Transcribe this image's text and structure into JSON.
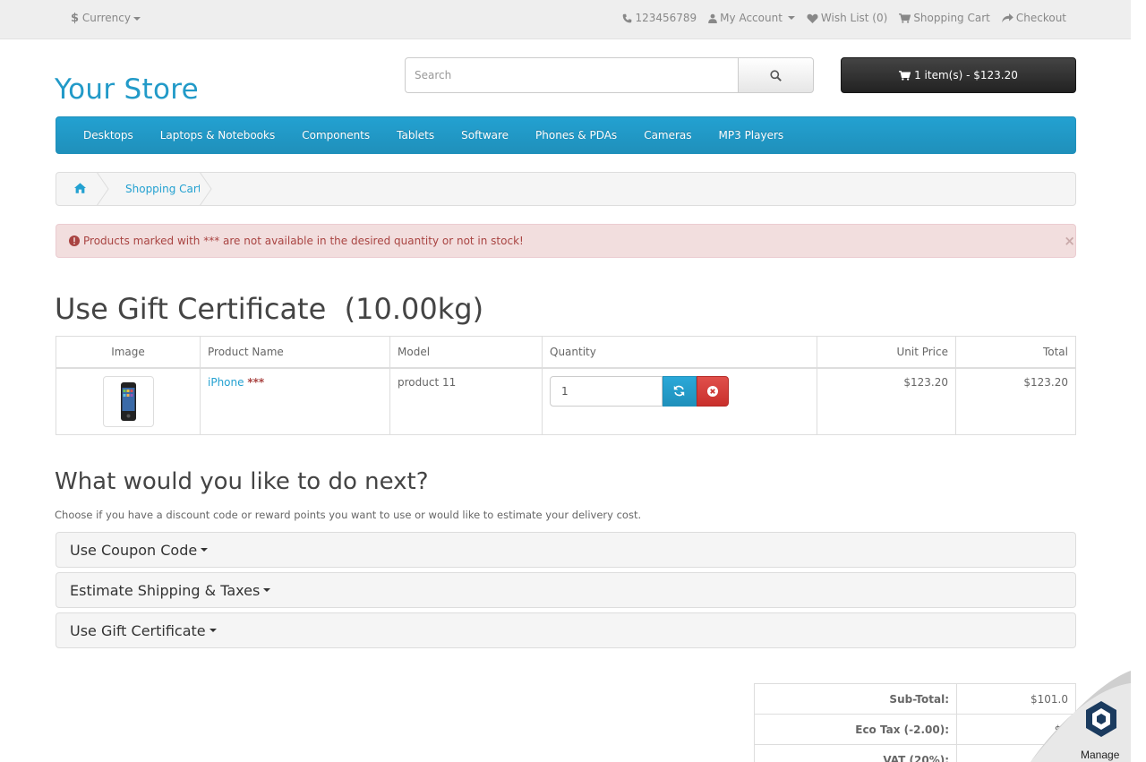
{
  "topbar": {
    "currency_symbol": "$",
    "currency_label": "Currency",
    "phone": "123456789",
    "my_account": "My Account",
    "wish_list": "Wish List (0)",
    "shopping_cart": "Shopping Cart",
    "checkout": "Checkout"
  },
  "header": {
    "logo": "Your Store",
    "search_placeholder": "Search",
    "cart_button": "1 item(s) - $123.20"
  },
  "menu": {
    "items": [
      "Desktops",
      "Laptops & Notebooks",
      "Components",
      "Tablets",
      "Software",
      "Phones & PDAs",
      "Cameras",
      "MP3 Players"
    ]
  },
  "breadcrumb": {
    "current": "Shopping Cart"
  },
  "alert": {
    "text": "Products marked with *** are not available in the desired quantity or not in stock!",
    "close": "×"
  },
  "page": {
    "title": "Use Gift Certificate  (10.00kg)"
  },
  "cart_table": {
    "headers": {
      "image": "Image",
      "product_name": "Product Name",
      "model": "Model",
      "quantity": "Quantity",
      "unit_price": "Unit Price",
      "total": "Total"
    },
    "rows": [
      {
        "product_name": "iPhone",
        "stock_marker": "***",
        "model": "product 11",
        "quantity": "1",
        "unit_price": "$123.20",
        "total": "$123.20"
      }
    ]
  },
  "next": {
    "title": "What would you like to do next?",
    "description": "Choose if you have a discount code or reward points you want to use or would like to estimate your delivery cost.",
    "panels": [
      "Use Coupon Code",
      "Estimate Shipping & Taxes",
      "Use Gift Certificate"
    ]
  },
  "totals": {
    "rows": [
      {
        "label": "Sub-Total:",
        "value": "$101.0"
      },
      {
        "label": "Eco Tax (-2.00):",
        "value": "$2"
      },
      {
        "label": "VAT (20%):",
        "value": ""
      }
    ]
  },
  "manage_badge": {
    "label": "Manage"
  },
  "colors": {
    "brand_blue": "#229ac8",
    "alert_text": "#a94442",
    "alert_bg": "#f2dede",
    "remove_red": "#c9302c",
    "cart_button_bg": "#303030"
  }
}
